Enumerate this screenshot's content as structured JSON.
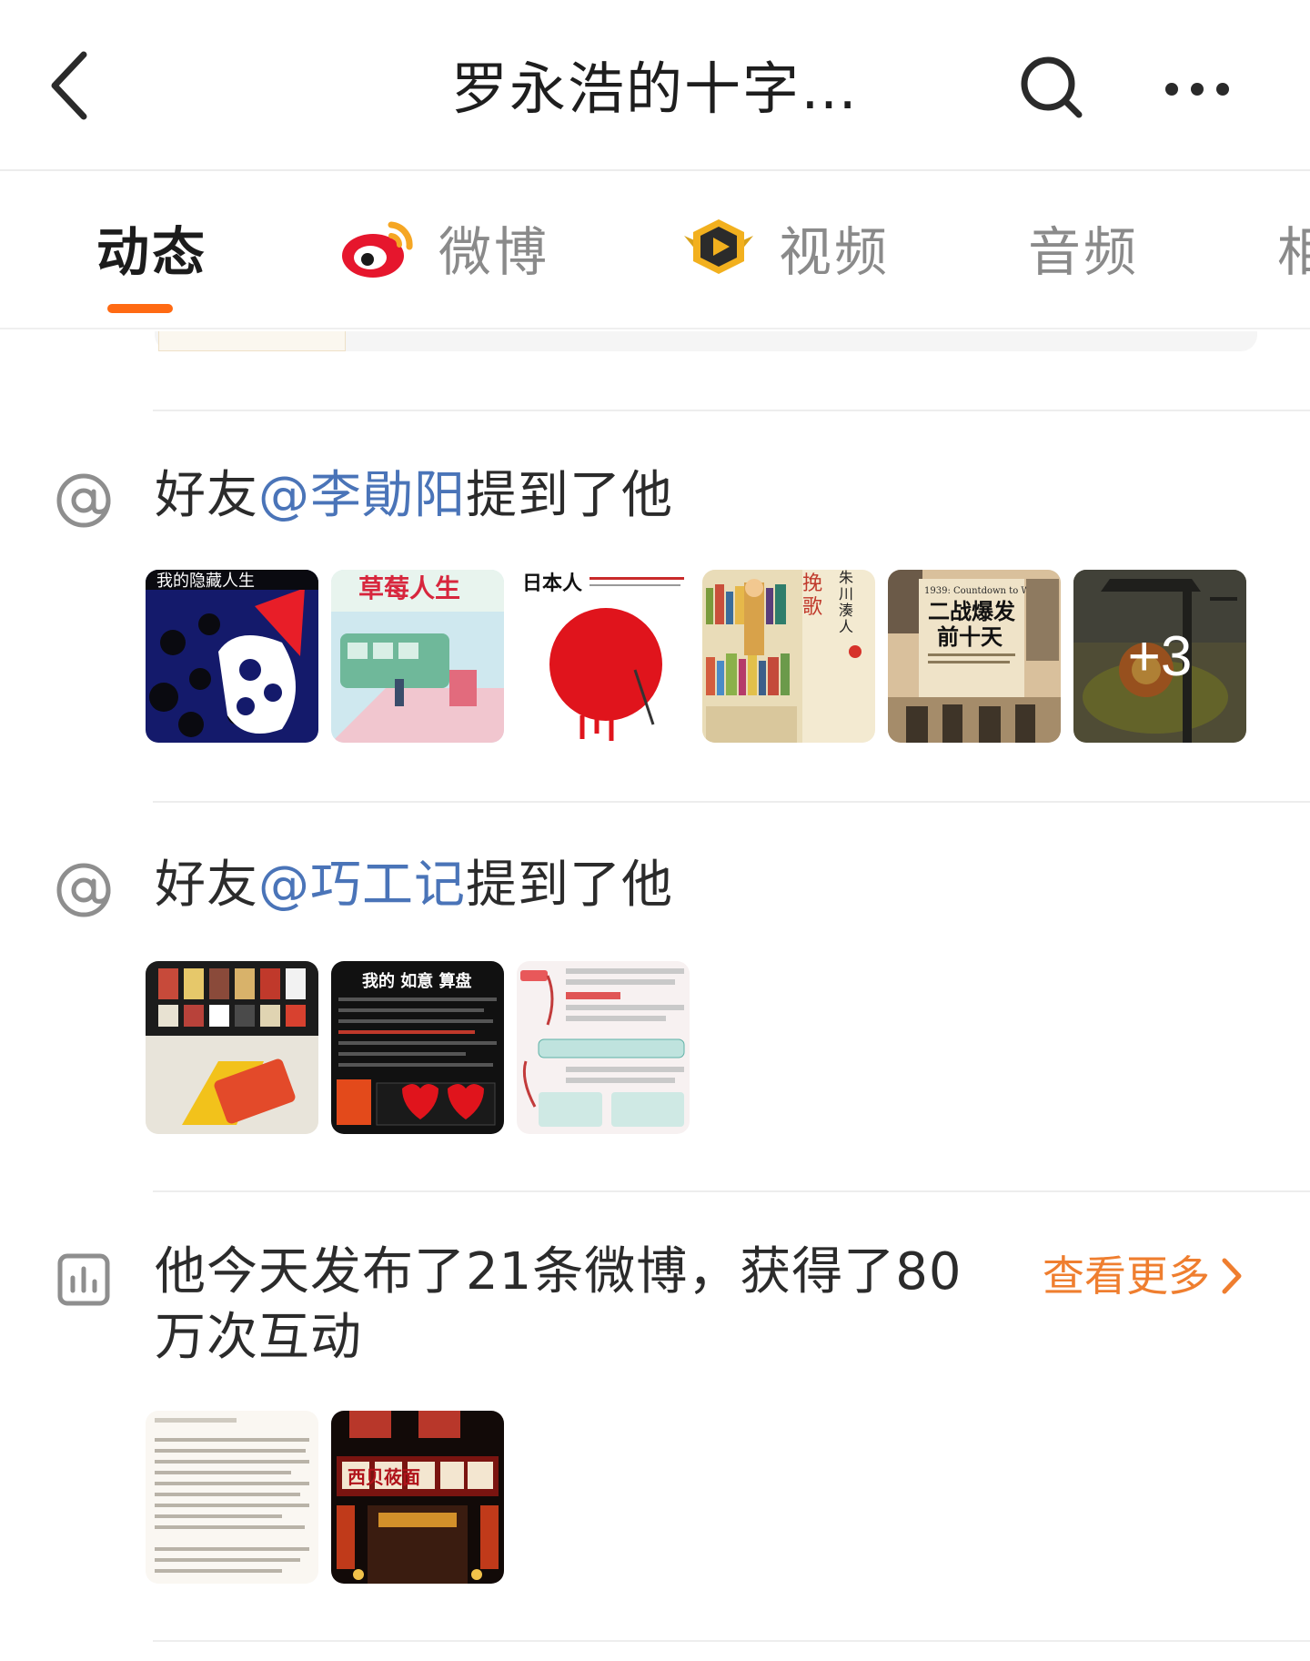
{
  "header": {
    "title": "罗永浩的十字…"
  },
  "tabs": [
    {
      "label": "动态",
      "icon": null
    },
    {
      "label": "微博",
      "icon": "weibo-logo-icon"
    },
    {
      "label": "视频",
      "icon": "video-play-icon"
    },
    {
      "label": "音频",
      "icon": null
    },
    {
      "label": "相册",
      "icon": null
    }
  ],
  "sections": [
    {
      "icon": "at-sign-icon",
      "prefix": "好友",
      "mention": "@李勛阳",
      "suffix": "提到了他",
      "images": [
        {
          "name": "book-cover-hidden-life",
          "text": "我的隐藏人生"
        },
        {
          "name": "book-cover-strawberry-life",
          "text": "草莓人生"
        },
        {
          "name": "book-cover-japanese",
          "text": "日本人"
        },
        {
          "name": "book-cover-elegy",
          "text": "挽歌"
        },
        {
          "name": "book-cover-ww2-countdown",
          "text": "二战爆发前十天"
        },
        {
          "name": "book-cover-war-art",
          "text": "",
          "overlay": "+3"
        }
      ]
    },
    {
      "icon": "at-sign-icon",
      "prefix": "好友",
      "mention": "@巧工记",
      "suffix": "提到了他",
      "images": [
        {
          "name": "photo-collage-phones",
          "text": ""
        },
        {
          "name": "infographic-abacus",
          "text": "我的 如意 算盘"
        },
        {
          "name": "mindmap-infographic",
          "text": ""
        }
      ]
    }
  ],
  "stats": {
    "icon": "bar-chart-icon",
    "text": "他今天发布了21条微博，获得了80万次互动",
    "see_more": "查看更多",
    "images": [
      {
        "name": "text-post-screenshot",
        "text": ""
      },
      {
        "name": "restaurant-night-photo",
        "text": "西贝莜面"
      }
    ]
  },
  "colors": {
    "accent": "#ff6a13",
    "mention": "#4a74b8",
    "see_more": "#ef7e2f"
  }
}
